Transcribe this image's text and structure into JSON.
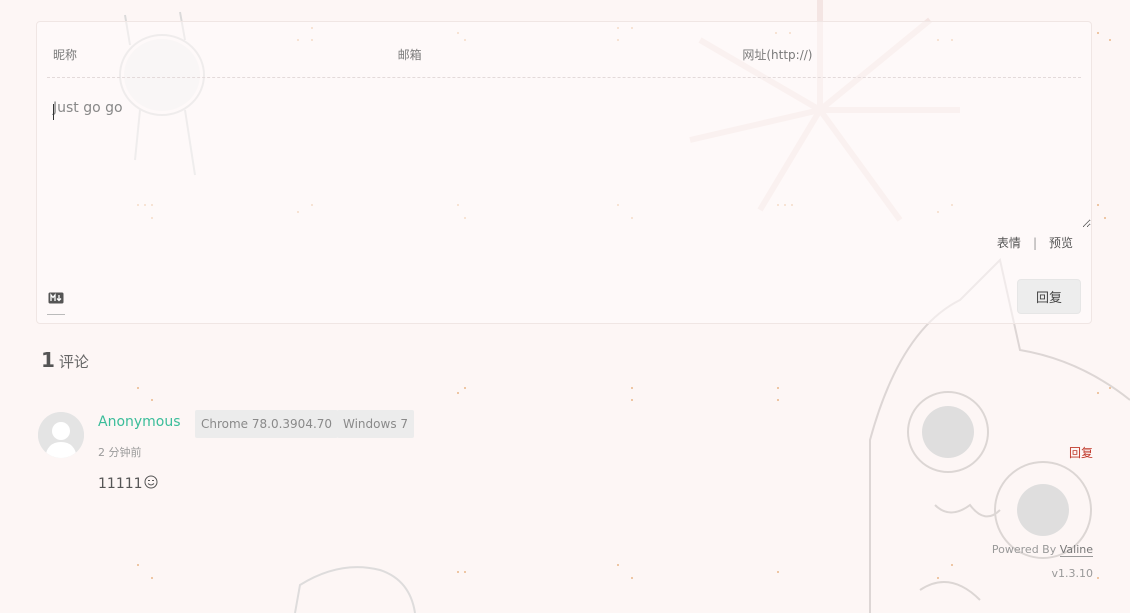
{
  "form": {
    "nick_placeholder": "昵称",
    "mail_placeholder": "邮箱",
    "link_placeholder": "网址(http://)",
    "comment_placeholder": "Just go go",
    "emoji_label": "表情",
    "preview_label": "预览",
    "submit_label": "回复",
    "markdown_icon": "markdown-icon"
  },
  "comments": {
    "count": "1",
    "count_label": "评论",
    "items": [
      {
        "nick": "Anonymous",
        "browser": "Chrome 78.0.3904.70",
        "os": "Windows 7",
        "time": "2 分钟前",
        "reply_label": "回复",
        "content": "11111",
        "emoji_icon": "smile-emoji-icon"
      }
    ]
  },
  "footer": {
    "powered_by": "Powered By",
    "brand": "Valine",
    "version": "v1.3.10"
  },
  "colors": {
    "nick": "#3bbd9a",
    "reply": "#c0392b",
    "background": "#fdf6f5"
  }
}
